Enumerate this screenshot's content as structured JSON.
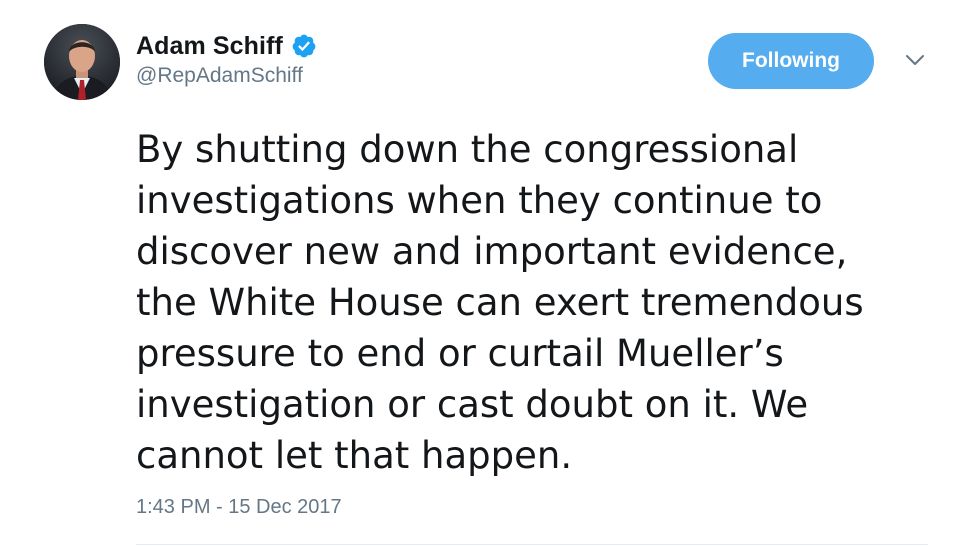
{
  "tweet": {
    "author": {
      "name": "Adam Schiff",
      "handle": "@RepAdamSchiff",
      "verified": true
    },
    "follow_button_label": "Following",
    "text": "By shutting down the congressional\ninvestigations when they continue to\ndiscover new and important evidence,\nthe White House can exert tremendous\npressure to end or curtail Mueller’s\ninvestigation or cast doubt on it. We\ncannot let that happen.",
    "timestamp": "1:43 PM - 15 Dec 2017"
  },
  "colors": {
    "accent": "#55acee",
    "verified": "#1da1f2",
    "secondary_text": "#657786",
    "primary_text": "#14171a"
  },
  "icons": {
    "verified": "verified-badge-icon",
    "menu": "chevron-down-icon"
  }
}
